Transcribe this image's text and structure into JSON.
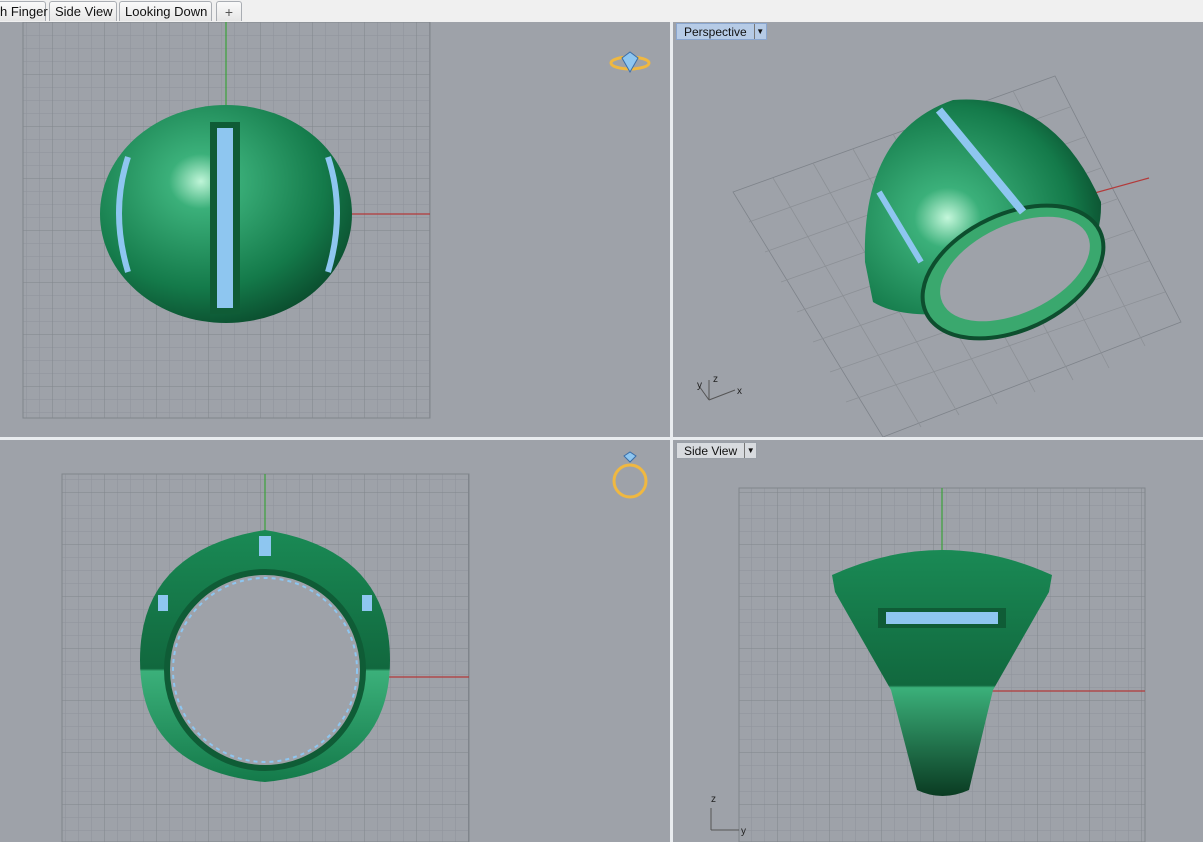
{
  "tabs": [
    {
      "label": "h Finger"
    },
    {
      "label": "Side View"
    },
    {
      "label": "Looking Down"
    },
    {
      "label": "+"
    }
  ],
  "viewports": {
    "top_left": {
      "label": ""
    },
    "top_right": {
      "label": "Perspective",
      "active": true
    },
    "bottom_left": {
      "label": ""
    },
    "bottom_right": {
      "label": "Side View"
    }
  },
  "axes": {
    "perspective": {
      "x": "x",
      "y": "y",
      "z": "z"
    },
    "side": {
      "y": "y",
      "z": "z"
    }
  },
  "colors": {
    "viewport_bg": "#9ea2a9",
    "grid": "#8c9096",
    "ring_green": "#1f8a58",
    "gem_blue": "#8ec6f0",
    "x_axis": "#b33a3a",
    "y_axis": "#3aa23a",
    "active_label_bg": "#b6cbe6",
    "widget_gold": "#f0b840"
  },
  "icons": {
    "plus": "plus-icon",
    "dropdown": "chevron-down-icon",
    "view_widget": "ring-gem-icon"
  }
}
